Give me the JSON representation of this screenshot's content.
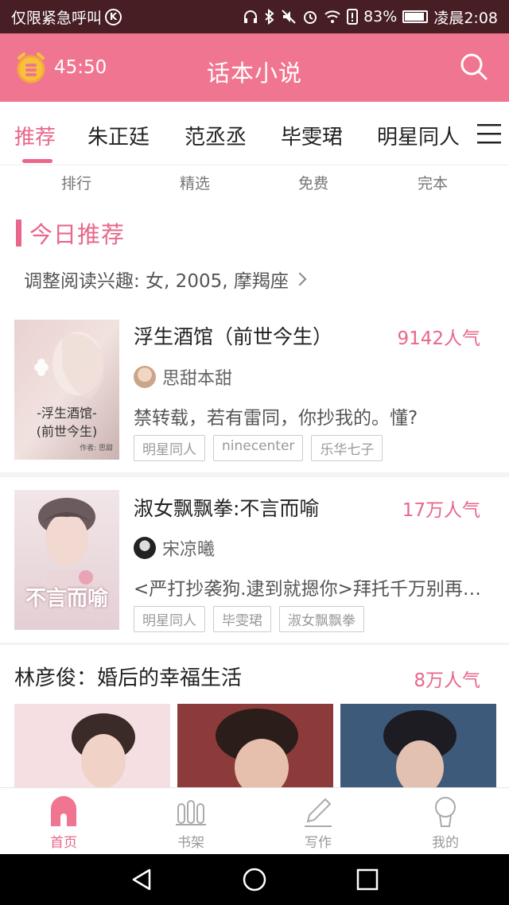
{
  "status_bar": {
    "carrier": "仅限紧急呼叫",
    "k_badge": "K",
    "battery": "83%",
    "time": "凌晨2:08"
  },
  "app_bar": {
    "timer": "45:50",
    "title": "话本小说"
  },
  "tabs": [
    "推荐",
    "朱正廷",
    "范丞丞",
    "毕雯珺",
    "明星同人"
  ],
  "subnav": [
    "排行",
    "精选",
    "免费",
    "完本"
  ],
  "section": {
    "title": "今日推荐",
    "interest": "调整阅读兴趣: 女, 2005, 摩羯座"
  },
  "books": [
    {
      "title": "浮生酒馆（前世今生）",
      "popularity": "9142人气",
      "author": "思甜本甜",
      "desc": "禁转载，若有雷同，你抄我的。懂?",
      "tags": [
        "明星同人",
        "ninecenter",
        "乐华七子"
      ],
      "cover_text": "-浮生酒馆-\n(前世今生)",
      "cover_author": "作者: 思甜"
    },
    {
      "title": "淑女飘飘拳:不言而喻",
      "popularity": "17万人气",
      "author": "宋凉曦",
      "desc": "<严打抄袭狗.逮到就摁你>拜托千万别再…",
      "tags": [
        "明星同人",
        "毕雯珺",
        "淑女飘飘拳"
      ],
      "cover_text": "不言而喻"
    }
  ],
  "feature": {
    "title": "林彦俊：婚后的幸福生活",
    "popularity": "8万人气"
  },
  "bottom_nav": [
    "首页",
    "书架",
    "写作",
    "我的"
  ],
  "colors": {
    "accent": "#e8678a",
    "app_bar": "#f07590",
    "status_bar": "#461e24"
  }
}
